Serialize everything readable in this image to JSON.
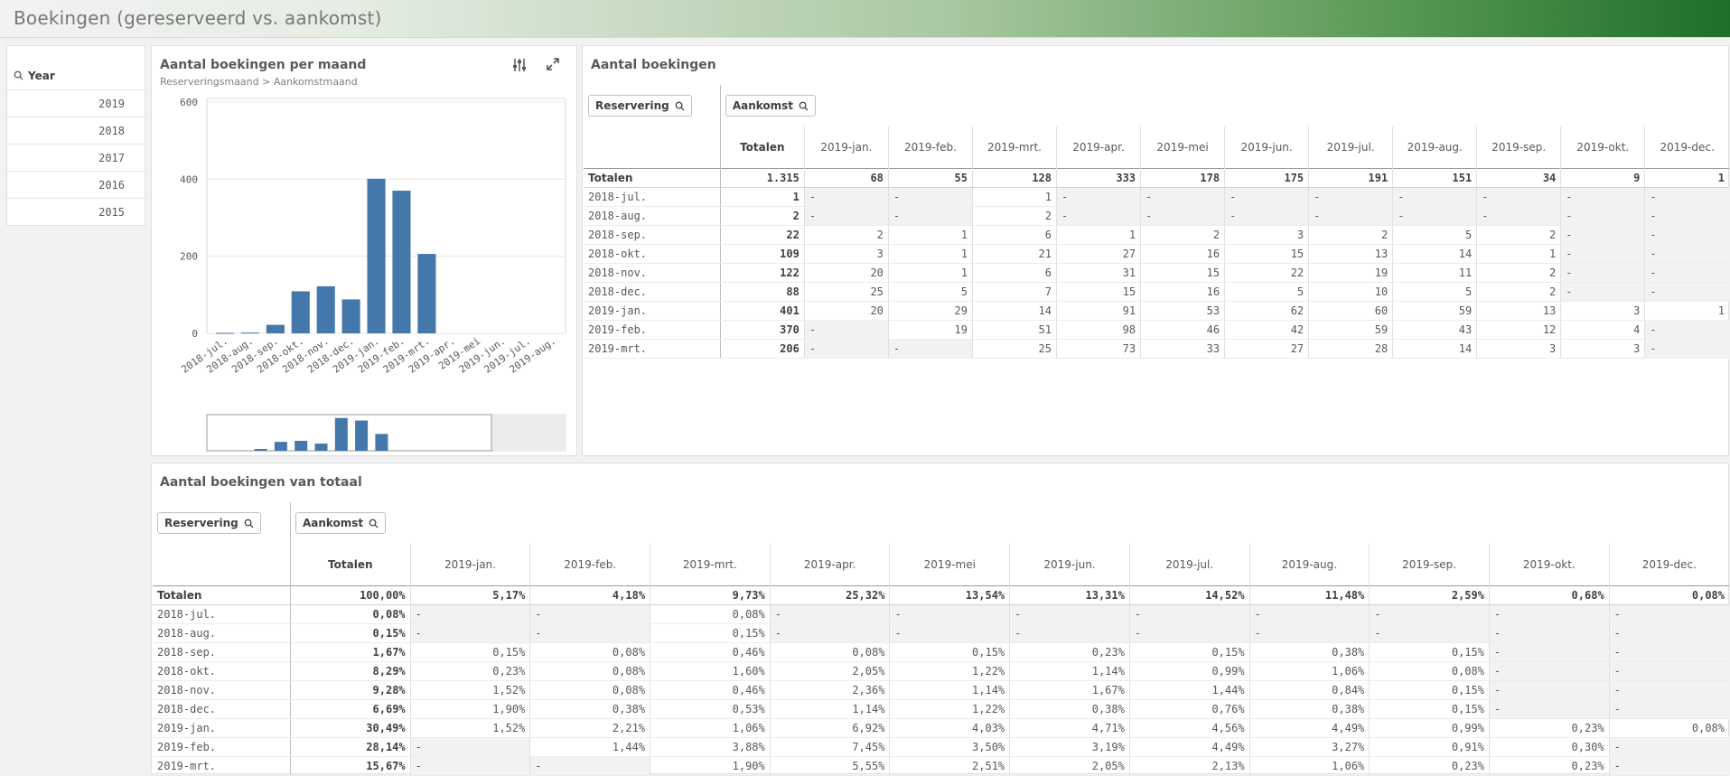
{
  "header": {
    "title": "Boekingen (gereserveerd vs. aankomst)"
  },
  "filter": {
    "title": "Year",
    "items": [
      "2019",
      "2018",
      "2017",
      "2016",
      "2015"
    ]
  },
  "chart": {
    "title": "Aantal boekingen per maand",
    "subtitle": "Reserveringsmaand > Aankomstmaand"
  },
  "chart_data": {
    "type": "bar",
    "categories": [
      "2018-jul.",
      "2018-aug.",
      "2018-sep.",
      "2018-okt.",
      "2018-nov.",
      "2018-dec.",
      "2019-jan.",
      "2019-feb.",
      "2019-mrt.",
      "2019-apr.",
      "2019-mei",
      "2019-jun.",
      "2019-jul.",
      "2019-aug."
    ],
    "values": [
      1,
      2,
      22,
      109,
      122,
      88,
      401,
      370,
      206,
      0,
      0,
      0,
      0,
      0
    ],
    "yticks": [
      "600",
      "400",
      "200",
      "0"
    ],
    "ylim": [
      0,
      600
    ],
    "color": "#4477aa"
  },
  "table1": {
    "title": "Aantal boekingen",
    "dim_row": "Reservering",
    "dim_col": "Aankomst",
    "columns": [
      "Totalen",
      "2019-jan.",
      "2019-feb.",
      "2019-mrt.",
      "2019-apr.",
      "2019-mei",
      "2019-jun.",
      "2019-jul.",
      "2019-aug.",
      "2019-sep.",
      "2019-okt.",
      "2019-dec."
    ],
    "totals": [
      "Totalen",
      "1.315",
      "68",
      "55",
      "128",
      "333",
      "178",
      "175",
      "191",
      "151",
      "34",
      "9",
      "1"
    ],
    "rows": [
      [
        "2018-jul.",
        "1",
        "-",
        "-",
        "1",
        "-",
        "-",
        "-",
        "-",
        "-",
        "-",
        "-",
        "-"
      ],
      [
        "2018-aug.",
        "2",
        "-",
        "-",
        "2",
        "-",
        "-",
        "-",
        "-",
        "-",
        "-",
        "-",
        "-"
      ],
      [
        "2018-sep.",
        "22",
        "2",
        "1",
        "6",
        "1",
        "2",
        "3",
        "2",
        "5",
        "2",
        "-",
        "-"
      ],
      [
        "2018-okt.",
        "109",
        "3",
        "1",
        "21",
        "27",
        "16",
        "15",
        "13",
        "14",
        "1",
        "-",
        "-"
      ],
      [
        "2018-nov.",
        "122",
        "20",
        "1",
        "6",
        "31",
        "15",
        "22",
        "19",
        "11",
        "2",
        "-",
        "-"
      ],
      [
        "2018-dec.",
        "88",
        "25",
        "5",
        "7",
        "15",
        "16",
        "5",
        "10",
        "5",
        "2",
        "-",
        "-"
      ],
      [
        "2019-jan.",
        "401",
        "20",
        "29",
        "14",
        "91",
        "53",
        "62",
        "60",
        "59",
        "13",
        "3",
        "1"
      ],
      [
        "2019-feb.",
        "370",
        "-",
        "19",
        "51",
        "98",
        "46",
        "42",
        "59",
        "43",
        "12",
        "4",
        "-"
      ],
      [
        "2019-mrt.",
        "206",
        "-",
        "-",
        "25",
        "73",
        "33",
        "27",
        "28",
        "14",
        "3",
        "3",
        "-"
      ]
    ]
  },
  "table2": {
    "title": "Aantal boekingen van totaal",
    "dim_row": "Reservering",
    "dim_col": "Aankomst",
    "columns": [
      "Totalen",
      "2019-jan.",
      "2019-feb.",
      "2019-mrt.",
      "2019-apr.",
      "2019-mei",
      "2019-jun.",
      "2019-jul.",
      "2019-aug.",
      "2019-sep.",
      "2019-okt.",
      "2019-dec."
    ],
    "totals": [
      "Totalen",
      "100,00%",
      "5,17%",
      "4,18%",
      "9,73%",
      "25,32%",
      "13,54%",
      "13,31%",
      "14,52%",
      "11,48%",
      "2,59%",
      "0,68%",
      "0,08%"
    ],
    "rows": [
      [
        "2018-jul.",
        "0,08%",
        "-",
        "-",
        "0,08%",
        "-",
        "-",
        "-",
        "-",
        "-",
        "-",
        "-",
        "-"
      ],
      [
        "2018-aug.",
        "0,15%",
        "-",
        "-",
        "0,15%",
        "-",
        "-",
        "-",
        "-",
        "-",
        "-",
        "-",
        "-"
      ],
      [
        "2018-sep.",
        "1,67%",
        "0,15%",
        "0,08%",
        "0,46%",
        "0,08%",
        "0,15%",
        "0,23%",
        "0,15%",
        "0,38%",
        "0,15%",
        "-",
        "-"
      ],
      [
        "2018-okt.",
        "8,29%",
        "0,23%",
        "0,08%",
        "1,60%",
        "2,05%",
        "1,22%",
        "1,14%",
        "0,99%",
        "1,06%",
        "0,08%",
        "-",
        "-"
      ],
      [
        "2018-nov.",
        "9,28%",
        "1,52%",
        "0,08%",
        "0,46%",
        "2,36%",
        "1,14%",
        "1,67%",
        "1,44%",
        "0,84%",
        "0,15%",
        "-",
        "-"
      ],
      [
        "2018-dec.",
        "6,69%",
        "1,90%",
        "0,38%",
        "0,53%",
        "1,14%",
        "1,22%",
        "0,38%",
        "0,76%",
        "0,38%",
        "0,15%",
        "-",
        "-"
      ],
      [
        "2019-jan.",
        "30,49%",
        "1,52%",
        "2,21%",
        "1,06%",
        "6,92%",
        "4,03%",
        "4,71%",
        "4,56%",
        "4,49%",
        "0,99%",
        "0,23%",
        "0,08%"
      ],
      [
        "2019-feb.",
        "28,14%",
        "-",
        "1,44%",
        "3,88%",
        "7,45%",
        "3,50%",
        "3,19%",
        "4,49%",
        "3,27%",
        "0,91%",
        "0,30%",
        "-"
      ],
      [
        "2019-mrt.",
        "15,67%",
        "-",
        "-",
        "1,90%",
        "5,55%",
        "2,51%",
        "2,05%",
        "2,13%",
        "1,06%",
        "0,23%",
        "0,23%",
        "-"
      ]
    ]
  }
}
